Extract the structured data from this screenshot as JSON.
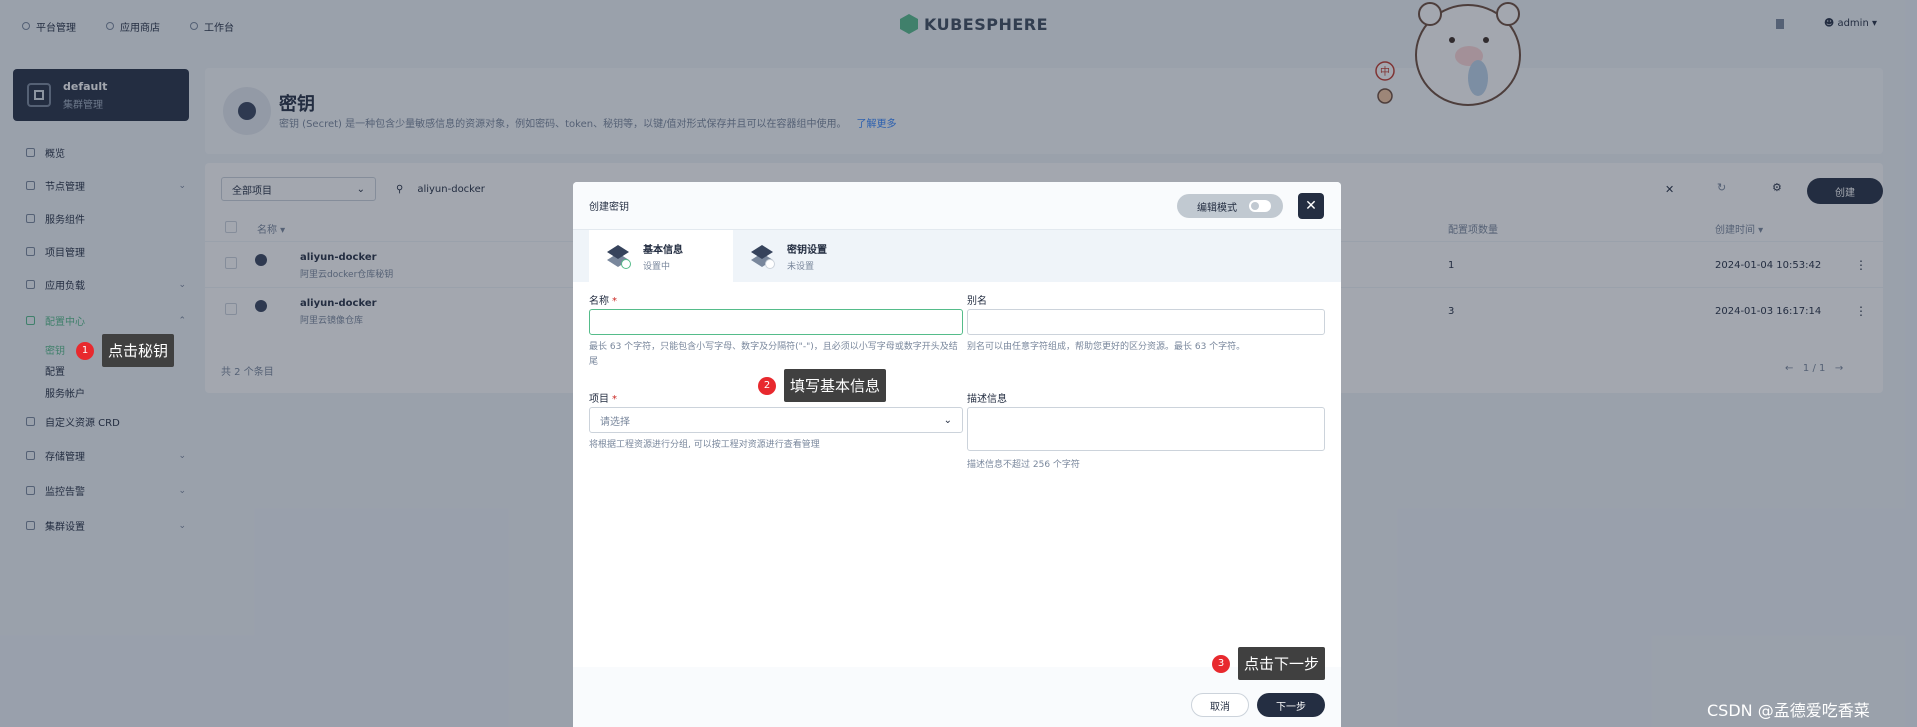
{
  "topbar": {
    "nav": [
      "平台管理",
      "应用商店",
      "工作台"
    ],
    "logo_text": "KUBESPHERE",
    "user": "admin"
  },
  "sidebar": {
    "cluster_name": "default",
    "cluster_sub": "集群管理",
    "items": [
      {
        "label": "概览"
      },
      {
        "label": "节点管理"
      },
      {
        "label": "服务组件"
      },
      {
        "label": "项目管理"
      },
      {
        "label": "应用负载"
      },
      {
        "label": "配置中心"
      },
      {
        "label": "自定义资源 CRD"
      },
      {
        "label": "存储管理"
      },
      {
        "label": "监控告警"
      },
      {
        "label": "集群设置"
      }
    ],
    "sub_items": [
      "密钥",
      "配置",
      "服务帐户"
    ]
  },
  "banner": {
    "title": "密钥",
    "description": "密钥 (Secret) 是一种包含少量敏感信息的资源对象，例如密码、token、秘钥等，以键/值对形式保存并且可以在容器组中使用。",
    "learn_more": "了解更多"
  },
  "list": {
    "project_filter": "全部项目",
    "search_value": "aliyun-docker",
    "create_label": "创建",
    "columns": {
      "name": "名称",
      "count": "配置项数量",
      "time": "创建时间"
    },
    "rows": [
      {
        "name": "aliyun-docker",
        "sub": "阿里云docker仓库秘钥",
        "count": "1",
        "time": "2024-01-04 10:53:42"
      },
      {
        "name": "aliyun-docker",
        "sub": "阿里云镜像仓库",
        "count": "3",
        "time": "2024-01-03 16:17:14"
      }
    ],
    "footer": "共 2 个条目",
    "pager": "1 / 1"
  },
  "modal": {
    "title": "创建密钥",
    "edit_mode": "编辑模式",
    "tabs": [
      {
        "title": "基本信息",
        "status": "设置中"
      },
      {
        "title": "密钥设置",
        "status": "未设置"
      }
    ],
    "name_label": "名称",
    "name_hint": "最长 63 个字符，只能包含小写字母、数字及分隔符(\"-\")，且必须以小写字母或数字开头及结尾",
    "alias_label": "别名",
    "alias_hint": "别名可以由任意字符组成，帮助您更好的区分资源。最长 63 个字符。",
    "project_label": "项目",
    "project_placeholder": "请选择",
    "project_hint": "将根据工程资源进行分组, 可以按工程对资源进行查看管理",
    "desc_label": "描述信息",
    "desc_hint": "描述信息不超过 256 个字符",
    "cancel": "取消",
    "next": "下一步"
  },
  "callouts": [
    {
      "num": "1",
      "text": "点击秘钥"
    },
    {
      "num": "2",
      "text": "填写基本信息"
    },
    {
      "num": "3",
      "text": "点击下一步"
    }
  ],
  "sticker_char": "中",
  "watermark": "CSDN @孟德爱吃香菜",
  "colors": {
    "accent": "#55bc8a",
    "dark": "#242e42",
    "callout_red": "#e8292e"
  }
}
